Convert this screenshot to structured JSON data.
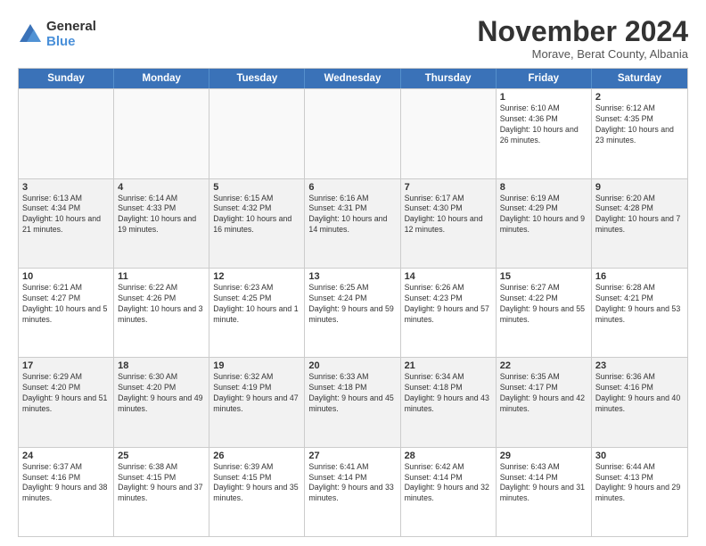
{
  "logo": {
    "general": "General",
    "blue": "Blue"
  },
  "title": "November 2024",
  "subtitle": "Morave, Berat County, Albania",
  "header": {
    "days": [
      "Sunday",
      "Monday",
      "Tuesday",
      "Wednesday",
      "Thursday",
      "Friday",
      "Saturday"
    ]
  },
  "rows": [
    {
      "alt": false,
      "cells": [
        {
          "day": "",
          "info": ""
        },
        {
          "day": "",
          "info": ""
        },
        {
          "day": "",
          "info": ""
        },
        {
          "day": "",
          "info": ""
        },
        {
          "day": "",
          "info": ""
        },
        {
          "day": "1",
          "info": "Sunrise: 6:10 AM\nSunset: 4:36 PM\nDaylight: 10 hours and 26 minutes."
        },
        {
          "day": "2",
          "info": "Sunrise: 6:12 AM\nSunset: 4:35 PM\nDaylight: 10 hours and 23 minutes."
        }
      ]
    },
    {
      "alt": true,
      "cells": [
        {
          "day": "3",
          "info": "Sunrise: 6:13 AM\nSunset: 4:34 PM\nDaylight: 10 hours and 21 minutes."
        },
        {
          "day": "4",
          "info": "Sunrise: 6:14 AM\nSunset: 4:33 PM\nDaylight: 10 hours and 19 minutes."
        },
        {
          "day": "5",
          "info": "Sunrise: 6:15 AM\nSunset: 4:32 PM\nDaylight: 10 hours and 16 minutes."
        },
        {
          "day": "6",
          "info": "Sunrise: 6:16 AM\nSunset: 4:31 PM\nDaylight: 10 hours and 14 minutes."
        },
        {
          "day": "7",
          "info": "Sunrise: 6:17 AM\nSunset: 4:30 PM\nDaylight: 10 hours and 12 minutes."
        },
        {
          "day": "8",
          "info": "Sunrise: 6:19 AM\nSunset: 4:29 PM\nDaylight: 10 hours and 9 minutes."
        },
        {
          "day": "9",
          "info": "Sunrise: 6:20 AM\nSunset: 4:28 PM\nDaylight: 10 hours and 7 minutes."
        }
      ]
    },
    {
      "alt": false,
      "cells": [
        {
          "day": "10",
          "info": "Sunrise: 6:21 AM\nSunset: 4:27 PM\nDaylight: 10 hours and 5 minutes."
        },
        {
          "day": "11",
          "info": "Sunrise: 6:22 AM\nSunset: 4:26 PM\nDaylight: 10 hours and 3 minutes."
        },
        {
          "day": "12",
          "info": "Sunrise: 6:23 AM\nSunset: 4:25 PM\nDaylight: 10 hours and 1 minute."
        },
        {
          "day": "13",
          "info": "Sunrise: 6:25 AM\nSunset: 4:24 PM\nDaylight: 9 hours and 59 minutes."
        },
        {
          "day": "14",
          "info": "Sunrise: 6:26 AM\nSunset: 4:23 PM\nDaylight: 9 hours and 57 minutes."
        },
        {
          "day": "15",
          "info": "Sunrise: 6:27 AM\nSunset: 4:22 PM\nDaylight: 9 hours and 55 minutes."
        },
        {
          "day": "16",
          "info": "Sunrise: 6:28 AM\nSunset: 4:21 PM\nDaylight: 9 hours and 53 minutes."
        }
      ]
    },
    {
      "alt": true,
      "cells": [
        {
          "day": "17",
          "info": "Sunrise: 6:29 AM\nSunset: 4:20 PM\nDaylight: 9 hours and 51 minutes."
        },
        {
          "day": "18",
          "info": "Sunrise: 6:30 AM\nSunset: 4:20 PM\nDaylight: 9 hours and 49 minutes."
        },
        {
          "day": "19",
          "info": "Sunrise: 6:32 AM\nSunset: 4:19 PM\nDaylight: 9 hours and 47 minutes."
        },
        {
          "day": "20",
          "info": "Sunrise: 6:33 AM\nSunset: 4:18 PM\nDaylight: 9 hours and 45 minutes."
        },
        {
          "day": "21",
          "info": "Sunrise: 6:34 AM\nSunset: 4:18 PM\nDaylight: 9 hours and 43 minutes."
        },
        {
          "day": "22",
          "info": "Sunrise: 6:35 AM\nSunset: 4:17 PM\nDaylight: 9 hours and 42 minutes."
        },
        {
          "day": "23",
          "info": "Sunrise: 6:36 AM\nSunset: 4:16 PM\nDaylight: 9 hours and 40 minutes."
        }
      ]
    },
    {
      "alt": false,
      "cells": [
        {
          "day": "24",
          "info": "Sunrise: 6:37 AM\nSunset: 4:16 PM\nDaylight: 9 hours and 38 minutes."
        },
        {
          "day": "25",
          "info": "Sunrise: 6:38 AM\nSunset: 4:15 PM\nDaylight: 9 hours and 37 minutes."
        },
        {
          "day": "26",
          "info": "Sunrise: 6:39 AM\nSunset: 4:15 PM\nDaylight: 9 hours and 35 minutes."
        },
        {
          "day": "27",
          "info": "Sunrise: 6:41 AM\nSunset: 4:14 PM\nDaylight: 9 hours and 33 minutes."
        },
        {
          "day": "28",
          "info": "Sunrise: 6:42 AM\nSunset: 4:14 PM\nDaylight: 9 hours and 32 minutes."
        },
        {
          "day": "29",
          "info": "Sunrise: 6:43 AM\nSunset: 4:14 PM\nDaylight: 9 hours and 31 minutes."
        },
        {
          "day": "30",
          "info": "Sunrise: 6:44 AM\nSunset: 4:13 PM\nDaylight: 9 hours and 29 minutes."
        }
      ]
    }
  ]
}
